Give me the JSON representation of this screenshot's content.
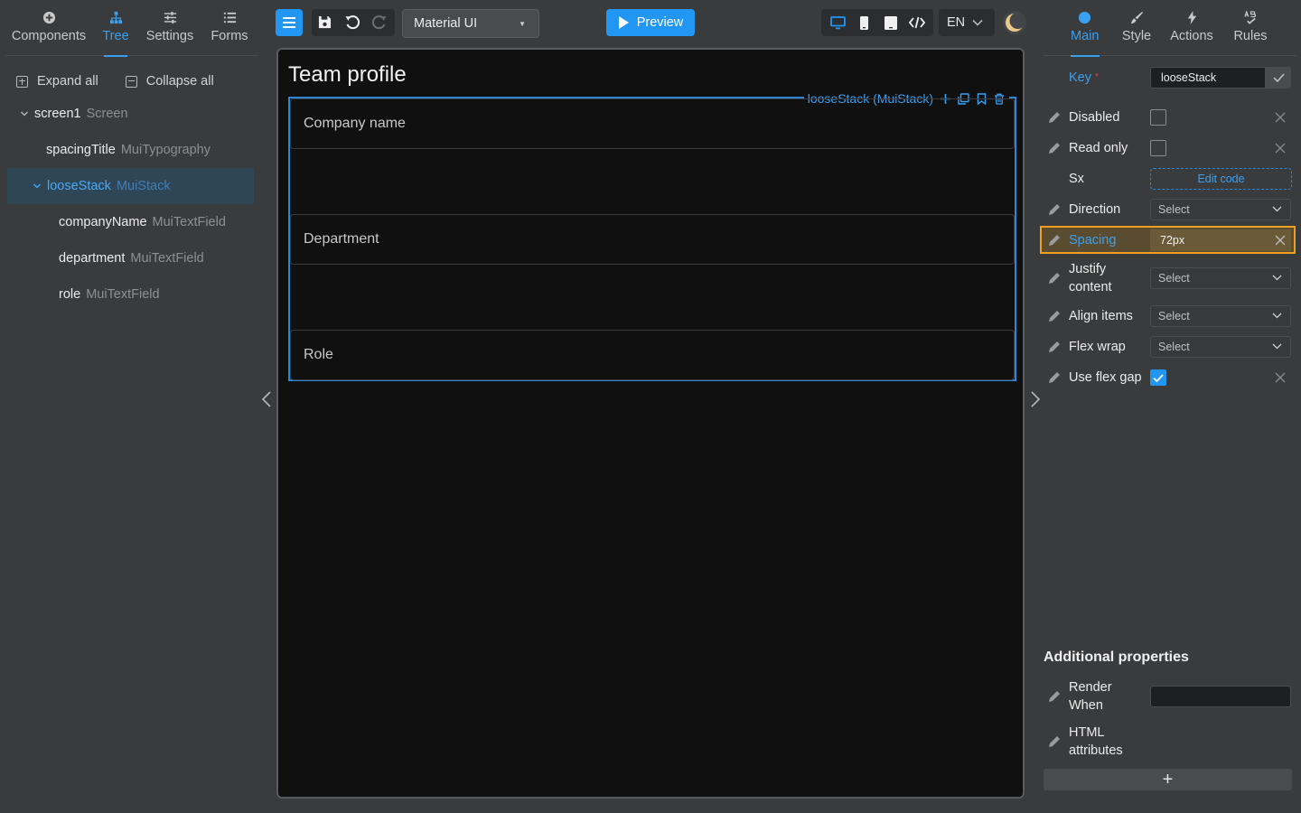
{
  "left_tabs": [
    {
      "label": "Components",
      "icon": "plus-circle-icon"
    },
    {
      "label": "Tree",
      "icon": "tree-icon"
    },
    {
      "label": "Settings",
      "icon": "sliders-icon"
    },
    {
      "label": "Forms",
      "icon": "list-icon"
    }
  ],
  "tree_actions": {
    "expand_all": "Expand all",
    "collapse_all": "Collapse all"
  },
  "tree": [
    {
      "name": "screen1",
      "type": "Screen"
    },
    {
      "name": "spacingTitle",
      "type": "MuiTypography"
    },
    {
      "name": "looseStack",
      "type": "MuiStack"
    },
    {
      "name": "companyName",
      "type": "MuiTextField"
    },
    {
      "name": "department",
      "type": "MuiTextField"
    },
    {
      "name": "role",
      "type": "MuiTextField"
    }
  ],
  "toolbar": {
    "library": "Material UI",
    "preview_label": "Preview",
    "language": "EN"
  },
  "canvas": {
    "title": "Team profile",
    "stack_label": "looseStack (MuiStack)",
    "fields": [
      "Company name",
      "Department",
      "Role"
    ]
  },
  "right_tabs": [
    {
      "label": "Main",
      "icon": "circle-icon"
    },
    {
      "label": "Style",
      "icon": "brush-icon"
    },
    {
      "label": "Actions",
      "icon": "bolt-icon"
    },
    {
      "label": "Rules",
      "icon": "rules-icon"
    }
  ],
  "props": {
    "key_label": "Key",
    "key_required": "*",
    "key_value": "looseStack",
    "disabled": "Disabled",
    "read_only": "Read only",
    "sx": "Sx",
    "edit_code": "Edit code",
    "direction": "Direction",
    "direction_value": "Select",
    "spacing": "Spacing",
    "spacing_value": "72px",
    "justify_content_1": "Justify",
    "justify_content_2": "content",
    "justify_value": "Select",
    "align_items": "Align items",
    "align_value": "Select",
    "flex_wrap": "Flex wrap",
    "flex_wrap_value": "Select",
    "use_flex_gap": "Use flex gap"
  },
  "additional": {
    "title": "Additional properties",
    "render_when_1": "Render",
    "render_when_2": "When",
    "html_attrs_1": "HTML",
    "html_attrs_2": "attributes",
    "add_symbol": "+"
  },
  "colors": {
    "accent": "#2196f3",
    "highlight": "#f0a020",
    "background": "#3a3b3d",
    "canvas": "#101010"
  }
}
